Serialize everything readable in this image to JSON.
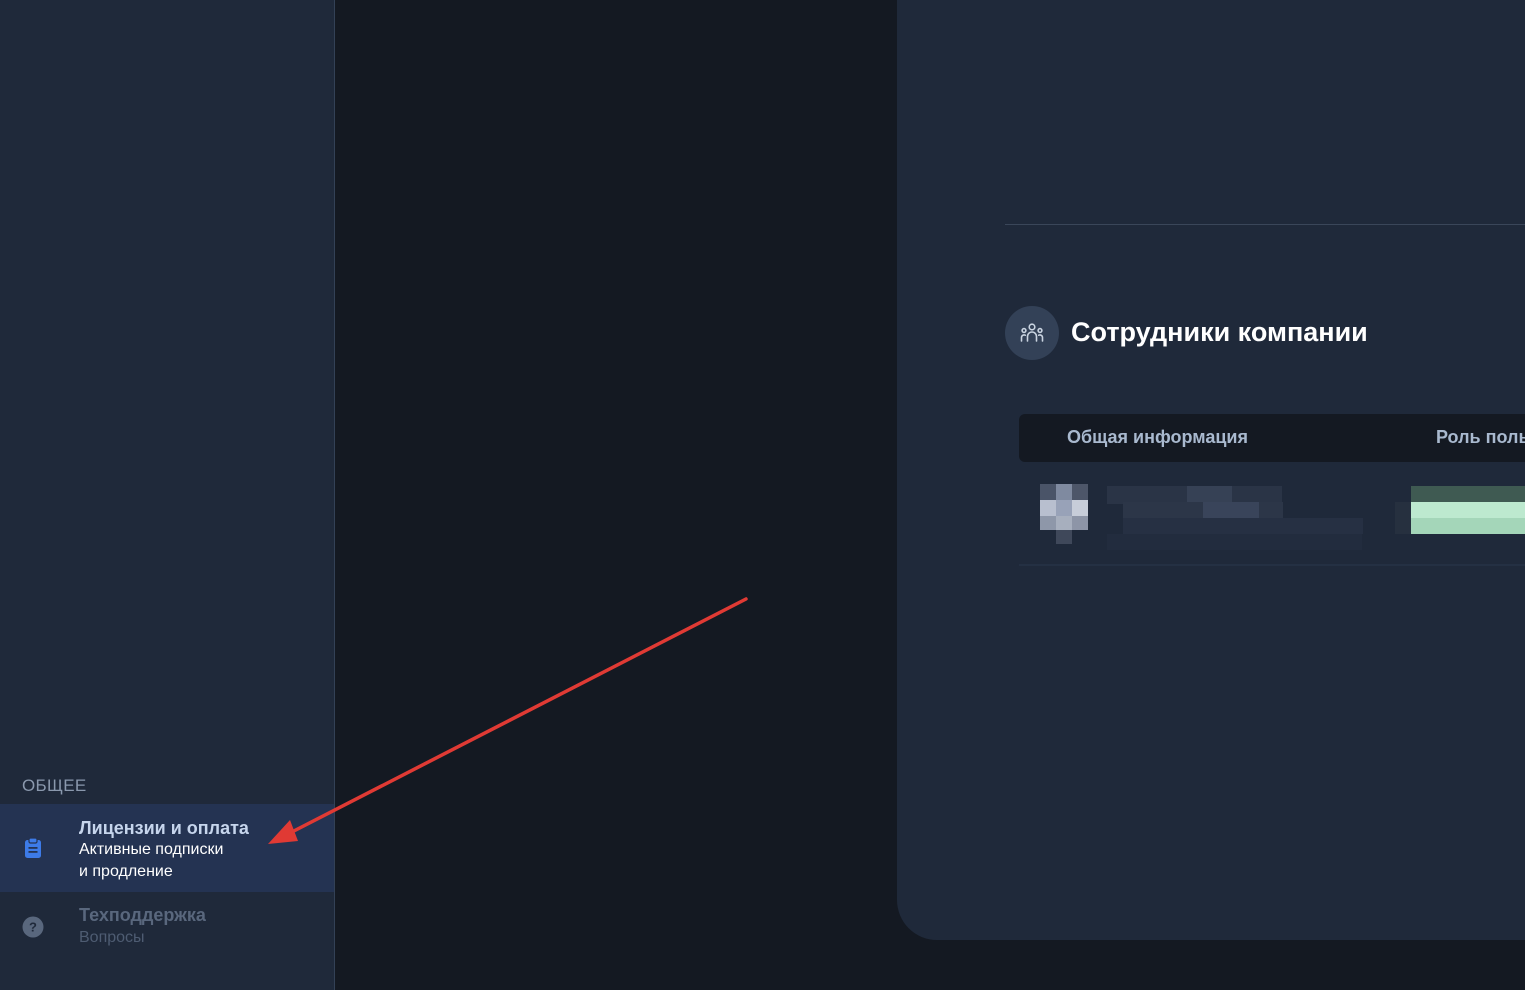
{
  "sidebar": {
    "section_label": "ОБЩЕЕ",
    "items": [
      {
        "title": "Лицензии и оплата",
        "subtitle": "Активные подписки\nи продление",
        "icon": "clipboard-icon",
        "active": true
      },
      {
        "title": "Техподдержка",
        "subtitle": "Вопросы",
        "icon": "question-icon",
        "active": false
      }
    ]
  },
  "main": {
    "section_title": "Сотрудники компании",
    "section_icon": "team-icon",
    "table": {
      "columns": [
        "Общая информация",
        "Роль поль"
      ]
    }
  },
  "annotation": {
    "color": "#e03a34"
  },
  "colors": {
    "background": "#141922",
    "panel": "#1f293a",
    "accent": "#3d7be8"
  }
}
